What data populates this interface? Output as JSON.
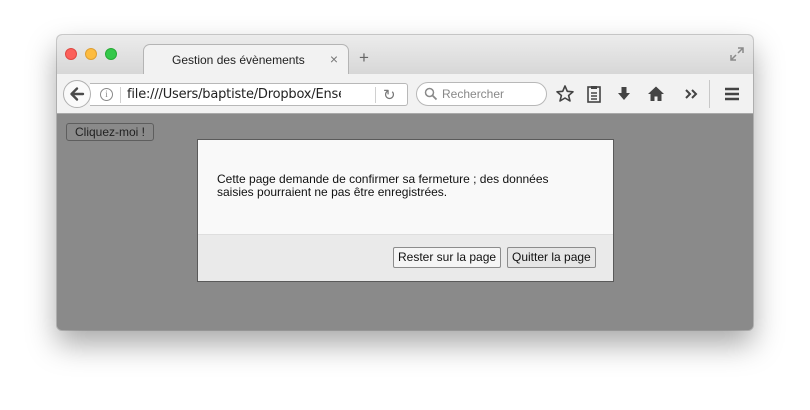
{
  "tab": {
    "title": "Gestion des évènements",
    "close_glyph": "×",
    "new_tab_glyph": "+"
  },
  "navbar": {
    "url": "file:///Users/baptiste/Dropbox/Enseignement",
    "info_glyph": "i",
    "reload_glyph": "↻",
    "search_placeholder": "Rechercher",
    "icons": [
      "back-icon",
      "bookmark-star-icon",
      "reading-list-icon",
      "download-icon",
      "home-icon",
      "overflow-chevron-icon",
      "hamburger-menu-icon"
    ]
  },
  "page": {
    "button_label": "Cliquez-moi !"
  },
  "dialog": {
    "message": "Cette page demande de confirmer sa fermeture ; des données saisies pourraient ne pas être enregistrées.",
    "stay_label": "Rester sur la page",
    "leave_label": "Quitter la page"
  }
}
